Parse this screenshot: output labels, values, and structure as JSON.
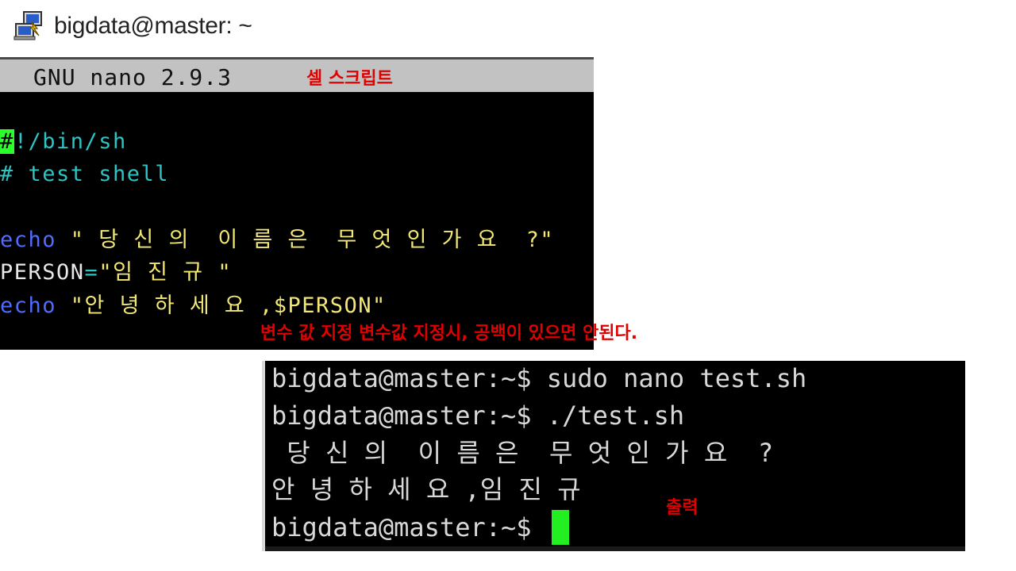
{
  "window": {
    "title": "bigdata@master: ~",
    "icon": "putty-icon"
  },
  "nano": {
    "version": "GNU nano 2.9.3",
    "annotation": "셀 스크립트",
    "lines": {
      "shebang_hash": "#",
      "shebang_rest": "!/bin/sh",
      "comment": "# test shell",
      "line3_kw": "echo",
      "line3_str": " \" 당 신 의  이 름 은  무 엇 인 가 요  ?\"",
      "line4_var": "PERSON",
      "line4_op": "=",
      "line4_str": "\"임 진 규 \"",
      "line5_kw": "echo",
      "line5_str": " \"안 녕 하 세 요 ,$PERSON\""
    },
    "variable_annotation": "변수 값 지정 변수값 지정시, 공백이 있으면 안된다."
  },
  "terminal": {
    "lines": [
      "bigdata@master:~$ sudo nano test.sh",
      "bigdata@master:~$ ./test.sh",
      " 당 신 의  이 름 은  무 엇 인 가 요  ?",
      "안 녕 하 세 요 ,임 진 규",
      "bigdata@master:~$ "
    ],
    "output_annotation": "출력"
  },
  "colors": {
    "annotation": "#e00000",
    "cursor": "#22ee22",
    "keyword": "#4f6cff",
    "string": "#f2e873",
    "comment": "#2ec4c4"
  }
}
